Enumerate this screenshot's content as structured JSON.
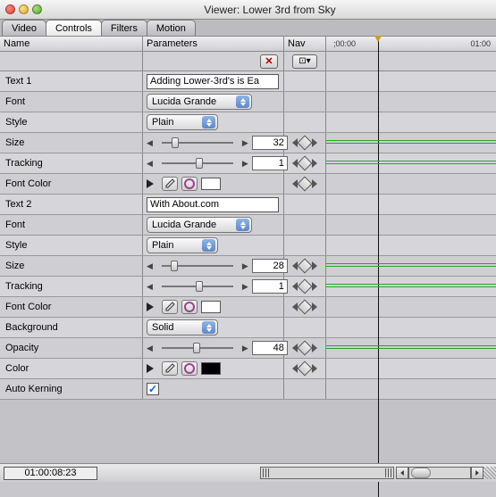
{
  "window": {
    "title": "Viewer: Lower 3rd from Sky"
  },
  "tabs": {
    "video": "Video",
    "controls": "Controls",
    "filters": "Filters",
    "motion": "Motion"
  },
  "columns": {
    "name": "Name",
    "parameters": "Parameters",
    "nav": "Nav"
  },
  "ruler": {
    "start": ";00:00",
    "end": "01:00"
  },
  "params": [
    {
      "label": "Text 1",
      "type": "text",
      "value": "Adding Lower-3rd's is Ea"
    },
    {
      "label": "Font",
      "type": "dropdown",
      "value": "Lucida Grande"
    },
    {
      "label": "Style",
      "type": "dropdown_narrow",
      "value": "Plain"
    },
    {
      "label": "Size",
      "type": "slider",
      "value": 32,
      "thumb_pct": 10,
      "nav": true,
      "track": true
    },
    {
      "label": "Tracking",
      "type": "slider",
      "value": 1,
      "thumb_pct": 48,
      "nav": true,
      "track": true
    },
    {
      "label": "Font Color",
      "type": "color",
      "swatch": "#ffffff",
      "nav": true
    },
    {
      "label": "Text 2",
      "type": "text",
      "value": "With About.com"
    },
    {
      "label": "Font",
      "type": "dropdown",
      "value": "Lucida Grande"
    },
    {
      "label": "Style",
      "type": "dropdown_narrow",
      "value": "Plain"
    },
    {
      "label": "Size",
      "type": "slider",
      "value": 28,
      "thumb_pct": 8,
      "nav": true,
      "track": true
    },
    {
      "label": "Tracking",
      "type": "slider",
      "value": 1,
      "thumb_pct": 48,
      "nav": true,
      "track": true
    },
    {
      "label": "Font Color",
      "type": "color",
      "swatch": "#ffffff",
      "nav": true
    },
    {
      "label": "Background",
      "type": "dropdown_narrow",
      "value": "Solid"
    },
    {
      "label": "Opacity",
      "type": "slider",
      "value": 48,
      "thumb_pct": 44,
      "nav": true,
      "track": true
    },
    {
      "label": "Color",
      "type": "color",
      "swatch": "#000000",
      "nav": true
    },
    {
      "label": "Auto Kerning",
      "type": "checkbox",
      "checked": true
    }
  ],
  "status": {
    "timecode": "01:00:08:23"
  }
}
